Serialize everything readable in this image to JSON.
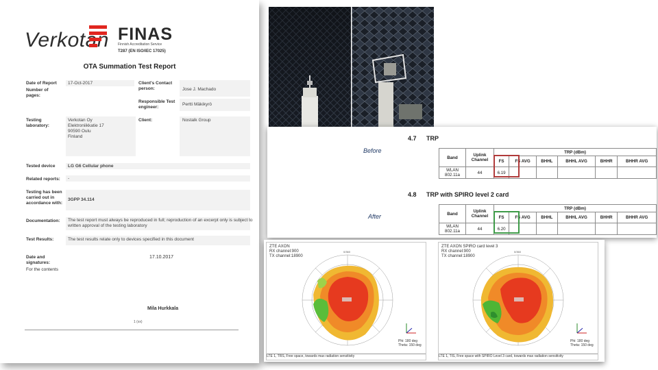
{
  "report": {
    "logo_verkotan": "Verkotan",
    "logo_finas": "FINAS",
    "finas_subtitle": "Finnish Accreditation Service",
    "finas_code": "T287 (EN ISO/IEC 17025)",
    "title": "OTA Summation Test Report",
    "date_of_report_label": "Date of Report",
    "date_of_report": "17-Oct-2017",
    "number_of_pages_label": "Number of pages:",
    "clients_contact_label": "Client's Contact person:",
    "clients_contact": "Jose J. Machado",
    "responsible_engineer_label": "Responsible Test engineer:",
    "responsible_engineer": "Pertti Mäkikyrö",
    "testing_lab_label": "Testing laboratory:",
    "testing_lab_lines": [
      "Verkotan Oy",
      "Elektroniikkatie 17",
      "90590 Oulu",
      "Finland"
    ],
    "client_label": "Client:",
    "client": "Nostalk Group",
    "tested_device_label": "Tested device",
    "tested_device": "LG G6 Cellular phone",
    "related_reports_label": "Related reports:",
    "related_reports": "-",
    "accordance_label": "Testing has been carried out in accordance with:",
    "accordance": "3GPP 34.114",
    "documentation_label": "Documentation:",
    "documentation": "The test report must always be reproduced in full; reproduction of an excerpt only is subject to written approval of the testing laboratory",
    "test_results_label": "Test Results:",
    "test_results": "The test results relate only to devices specified in this document",
    "date_signatures_label": "Date and signatures:",
    "for_contents": "For the contents",
    "signature_date": "17.10.2017",
    "signer": "Mila Hurkkala",
    "page_number": "1 (xx)"
  },
  "trp": {
    "before_label": "Before",
    "after_label": "After",
    "section1": {
      "number": "4.7",
      "title": "TRP"
    },
    "section2": {
      "number": "4.8",
      "title": "TRP with SPIRO level 2 card"
    },
    "headers": {
      "band": "Band",
      "uplink": "Uplink Channel",
      "trp_group": "TRP (dBm)",
      "cols": [
        "FS",
        "FS AVG",
        "BHHL",
        "BHHL AVG",
        "BHHR",
        "BHHR AVG"
      ]
    },
    "row_before": {
      "band": "WLAN 802.11a",
      "channel": "44",
      "fs": "6.19"
    },
    "row_after": {
      "band": "WLAN 802.11a",
      "channel": "44",
      "fs": "6.20"
    },
    "highlight_before": "#b03a3a",
    "highlight_after": "#3d9a47"
  },
  "patterns": {
    "left": {
      "title_lines": [
        "ZTE AXON",
        "RX channel:900",
        "TX channel:18900"
      ],
      "phi": "Phi:  180 deg",
      "theta": "Theta:  150 deg",
      "caption": "LTE 1, TRS, Free space, towards max radiation sensitivity"
    },
    "right": {
      "title_lines": [
        "ZTE AXON SPIRO card level 3",
        "RX channel:900",
        "TX channel:18900"
      ],
      "phi": "Phi:  180 deg",
      "theta": "Theta:  150 deg",
      "caption": "LTE 1, TIS, Free space with SPIRO Level 3 card, towards max radiation sensitivity"
    }
  }
}
